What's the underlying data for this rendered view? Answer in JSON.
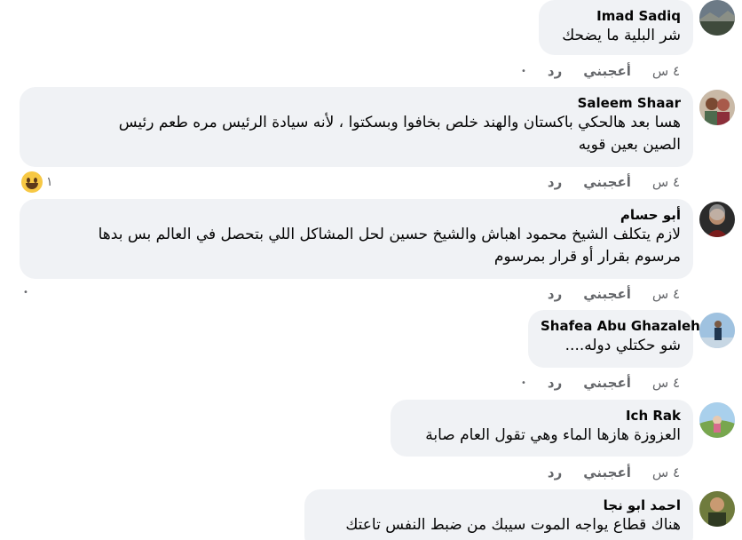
{
  "comments": [
    {
      "author": "Imad Sadiq",
      "text": "شر البلية ما يضحك",
      "time": "٤ س",
      "like": "أعجبني",
      "reply": "رد",
      "dot": "•"
    },
    {
      "author": "Saleem Shaar",
      "text": "هسا بعد هالحكي باكستان والهند خلص بخافوا وبسكتوا ، لأنه سيادة الرئيس مره طعم رئيس\nالصين بعين قويه",
      "time": "٤ س",
      "like": "أعجبني",
      "reply": "رد",
      "reaction_count": "١"
    },
    {
      "author": "أبو حسام",
      "text": "لازم يتكلف الشيخ محمود اهباش والشيخ حسين لحل المشاكل اللي بتحصل في العالم بس بدها\nمرسوم بقرار أو قرار بمرسوم",
      "time": "٤ س",
      "like": "أعجبني",
      "reply": "رد",
      "dot": "•"
    },
    {
      "author": "Shafea Abu Ghazaleh",
      "text": "شو حكتلي دوله....",
      "time": "٤ س",
      "like": "أعجبني",
      "reply": "رد",
      "dot": "•"
    },
    {
      "author": "Ich Rak",
      "text": "العزوزة هازها الماء وهي تقول العام صابة",
      "time": "٤ س",
      "like": "أعجبني",
      "reply": "رد"
    },
    {
      "author": "احمد ابو نجا",
      "text": "هناك قطاع يواجه الموت سيبك من ضبط النفس تاعتك"
    }
  ],
  "colors": {
    "bubble": "#f0f2f5",
    "meta": "#65676b",
    "text": "#050505",
    "emoji": "#f7c844"
  }
}
